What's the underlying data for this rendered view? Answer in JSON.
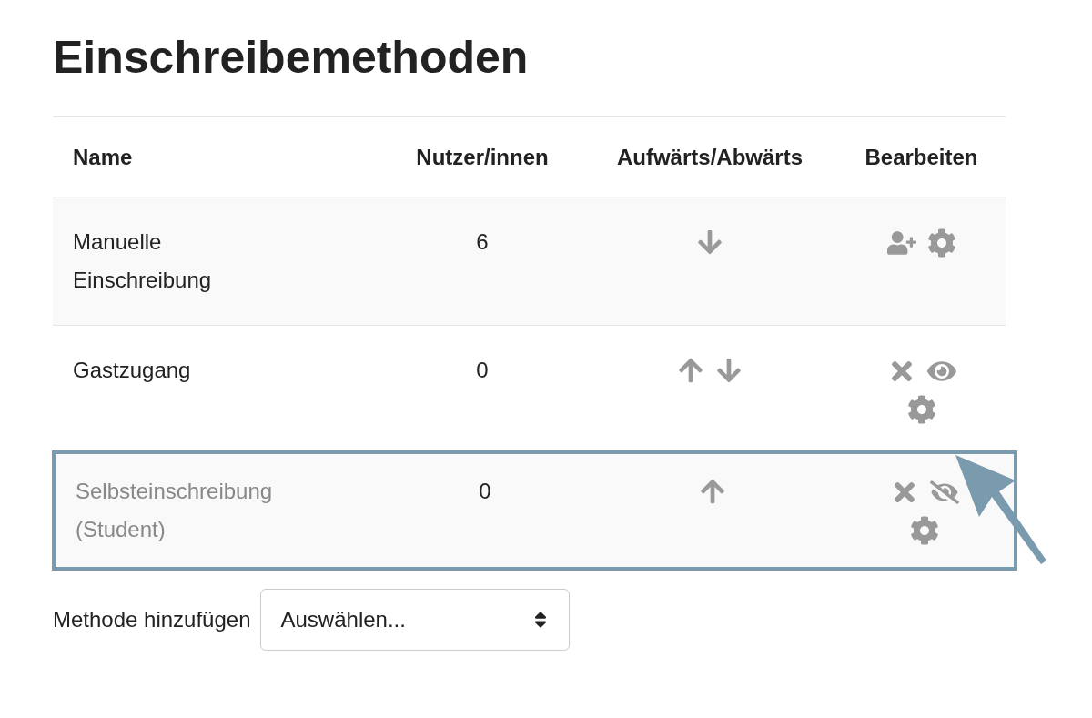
{
  "title": "Einschreibemethoden",
  "table": {
    "columns": [
      "Name",
      "Nutzer/innen",
      "Aufwärts/Abwärts",
      "Bearbeiten"
    ],
    "rows": [
      {
        "name": "Manuelle Einschreibung",
        "users": "6",
        "up": false,
        "down": true,
        "disabled": false,
        "highlighted": false,
        "actions": [
          {
            "kind": "enrol"
          },
          {
            "kind": "settings"
          }
        ]
      },
      {
        "name": "Gastzugang",
        "users": "0",
        "up": true,
        "down": true,
        "disabled": false,
        "highlighted": false,
        "actions": [
          {
            "kind": "delete"
          },
          {
            "kind": "visible"
          },
          {
            "kind": "settings"
          }
        ]
      },
      {
        "name": "Selbsteinschreibung (Student)",
        "users": "0",
        "up": true,
        "down": false,
        "disabled": true,
        "highlighted": true,
        "actions": [
          {
            "kind": "delete"
          },
          {
            "kind": "hidden"
          },
          {
            "kind": "settings"
          }
        ]
      }
    ]
  },
  "add_method": {
    "label": "Methode hinzufügen",
    "select": {
      "value": "Auswählen..."
    }
  },
  "callout": {
    "kind": "arrow"
  }
}
